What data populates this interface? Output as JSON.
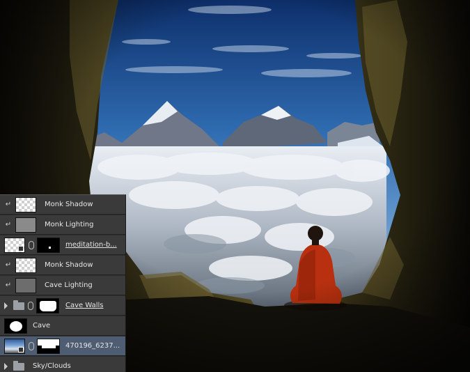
{
  "colors": {
    "panel_bg": "#2e2e2e",
    "row_bg": "#3a3a3a",
    "row_selected": "#4f5d73",
    "text": "#e6e6e6"
  },
  "layers": [
    {
      "name": "Monk Shadow",
      "thumb": "checker",
      "clipped": true
    },
    {
      "name": "Monk Lighting",
      "thumb": "gray",
      "clipped": true
    },
    {
      "name": "meditation-b...",
      "thumb": "checker",
      "has_mask": true,
      "smart_object": true
    },
    {
      "name": "Monk Shadow",
      "thumb": "checker",
      "clipped": true
    },
    {
      "name": "Cave Lighting",
      "thumb": "darkgray",
      "clipped": true
    },
    {
      "name": "Cave Walls",
      "group": true,
      "has_mask": true
    },
    {
      "name": "Cave",
      "thumb": "black-white"
    },
    {
      "name": "470196_6237...",
      "thumb": "photo",
      "has_mask": true,
      "selected": true
    },
    {
      "name": "Sky/Clouds",
      "group": true
    }
  ],
  "icons": {
    "clip": "clipping-arrow-icon",
    "folder": "folder-icon",
    "link": "chain-link-icon",
    "expand": "triangle-right-icon"
  }
}
